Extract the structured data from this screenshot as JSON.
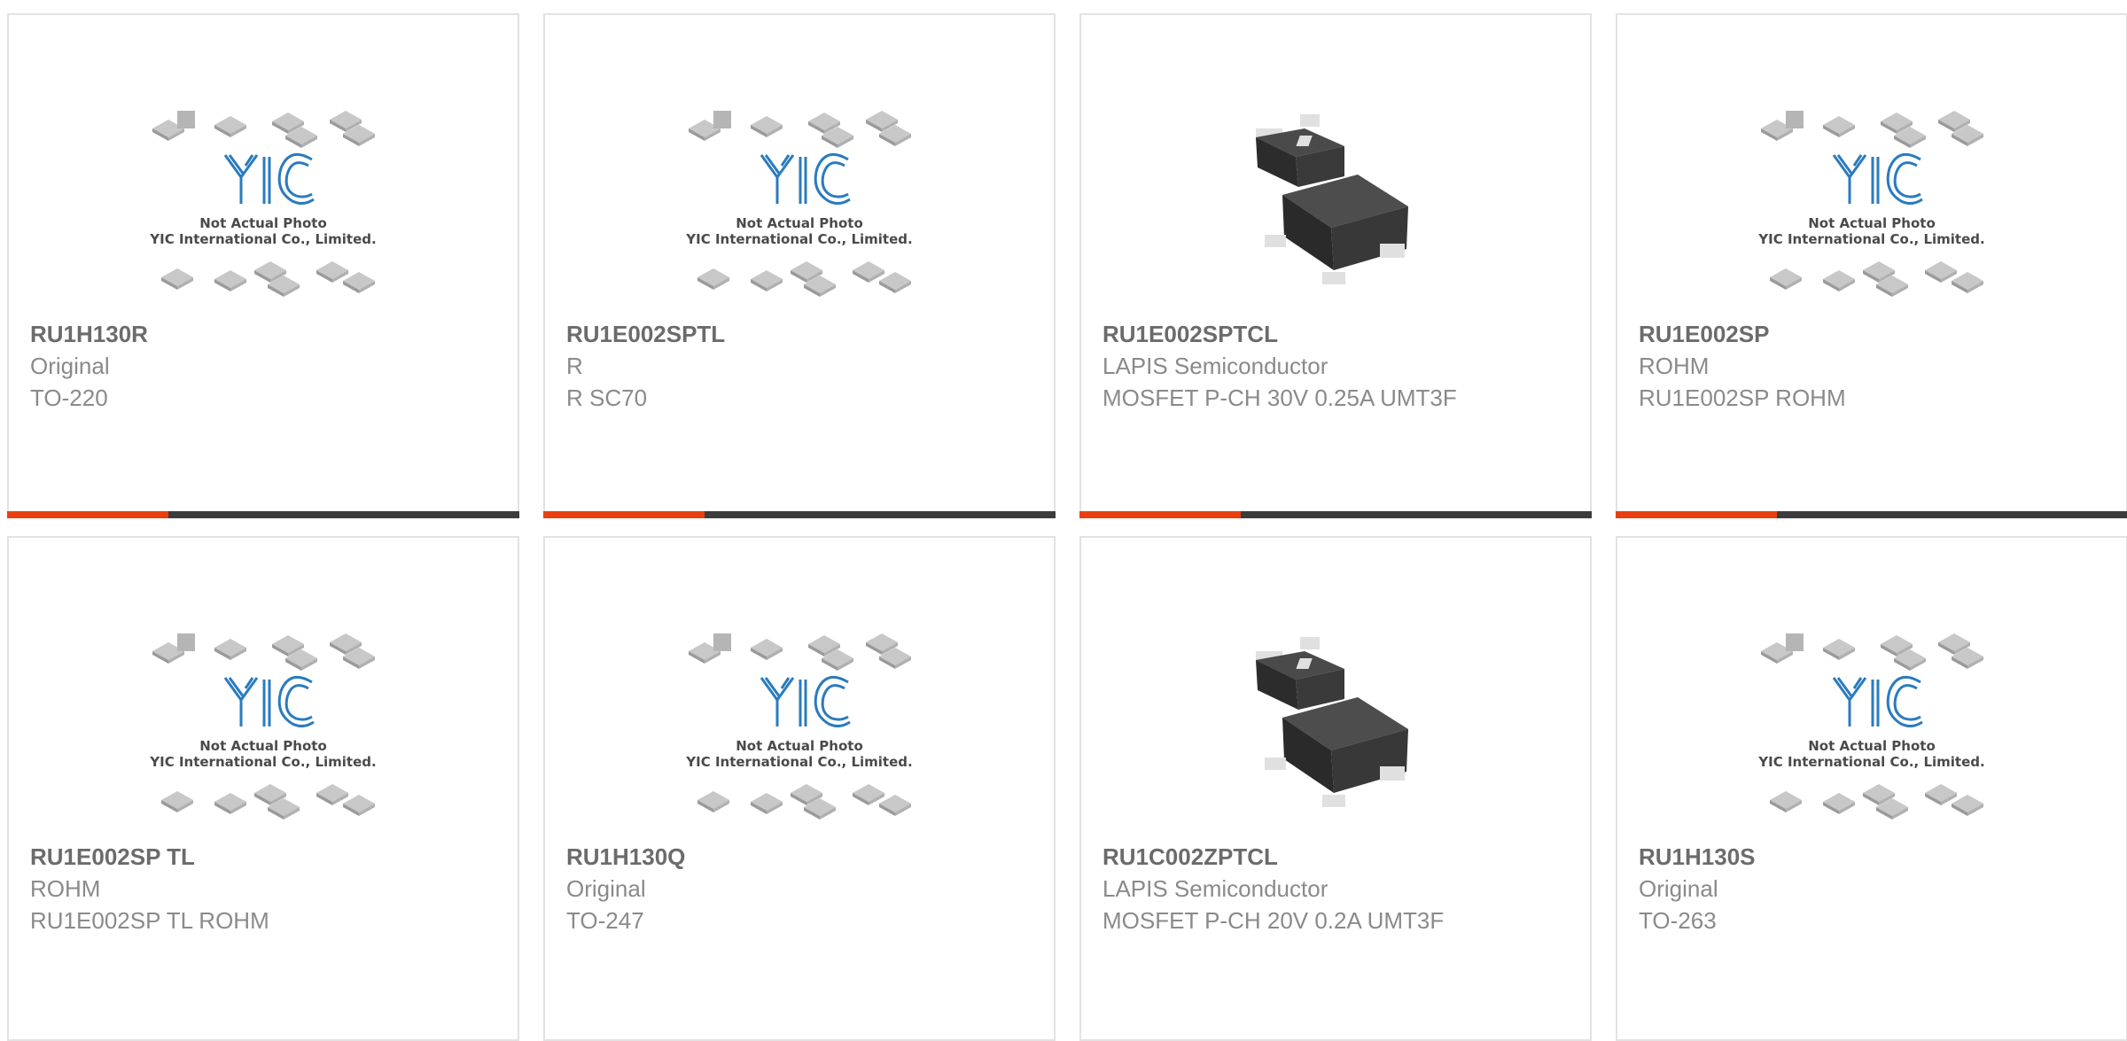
{
  "placeholder": {
    "caption_line1": "Not Actual Photo",
    "caption_line2": "YIC International Co., Limited.",
    "logo_text": "YIC"
  },
  "colors": {
    "accent": "#e84010",
    "bar": "#3c3c3c",
    "border": "#e2e2e2",
    "logo": "#2a7bbf"
  },
  "products": [
    {
      "part_number": "RU1H130R",
      "manufacturer": "Original",
      "description": "TO-220",
      "image": "placeholder"
    },
    {
      "part_number": "RU1E002SPTL",
      "manufacturer": "R",
      "description": "R SC70",
      "image": "placeholder"
    },
    {
      "part_number": "RU1E002SPTCL",
      "manufacturer": "LAPIS Semiconductor",
      "description": "MOSFET P-CH 30V 0.25A UMT3F",
      "image": "sot-package"
    },
    {
      "part_number": "RU1E002SP",
      "manufacturer": "ROHM",
      "description": "RU1E002SP ROHM",
      "image": "placeholder"
    },
    {
      "part_number": "RU1E002SP TL",
      "manufacturer": "ROHM",
      "description": "RU1E002SP TL ROHM",
      "image": "placeholder"
    },
    {
      "part_number": "RU1H130Q",
      "manufacturer": "Original",
      "description": "TO-247",
      "image": "placeholder"
    },
    {
      "part_number": "RU1C002ZPTCL",
      "manufacturer": "LAPIS Semiconductor",
      "description": "MOSFET P-CH 20V 0.2A UMT3F",
      "image": "sot-package"
    },
    {
      "part_number": "RU1H130S",
      "manufacturer": "Original",
      "description": "TO-263",
      "image": "placeholder"
    }
  ]
}
